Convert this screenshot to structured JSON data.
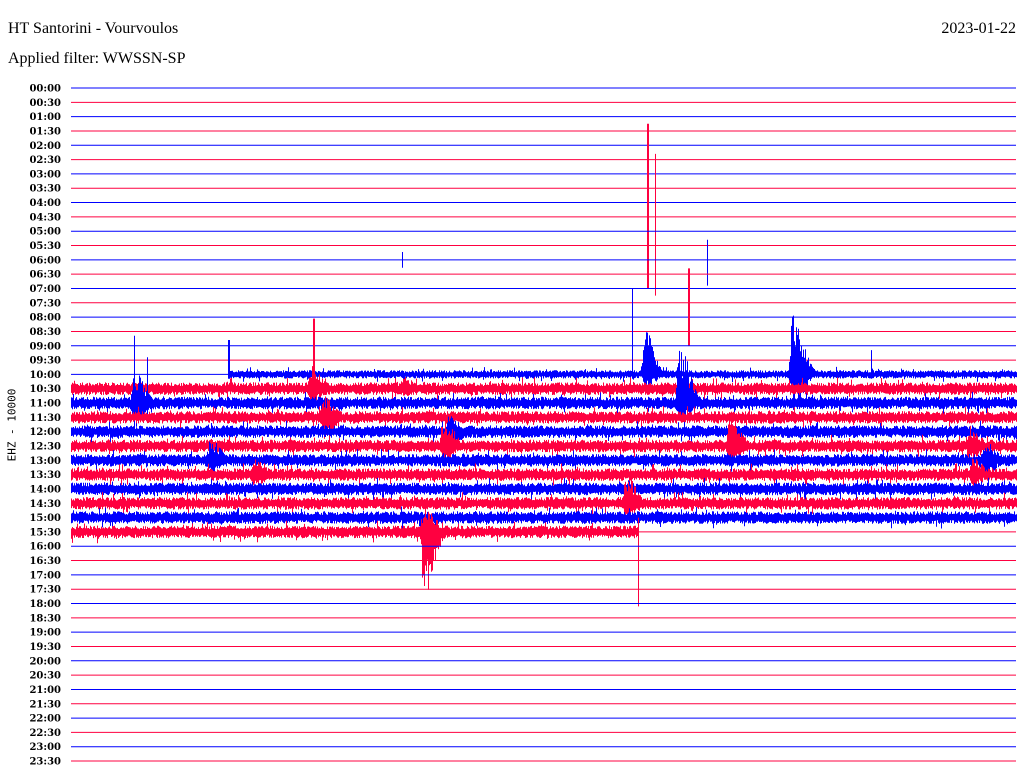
{
  "header": {
    "title": "HT Santorini - Vourvoulos",
    "filter": "Applied filter: WWSSN-SP",
    "date": "2023-01-22"
  },
  "chart_data": {
    "type": "helicorder",
    "ylabel": "EHZ - 10000",
    "minutes_per_row": 30,
    "row_labels": [
      "00:00",
      "00:30",
      "01:00",
      "01:30",
      "02:00",
      "02:30",
      "03:00",
      "03:30",
      "04:00",
      "04:30",
      "05:00",
      "05:30",
      "06:00",
      "06:30",
      "07:00",
      "07:30",
      "08:00",
      "08:30",
      "09:00",
      "09:30",
      "10:00",
      "10:30",
      "11:00",
      "11:30",
      "12:00",
      "12:30",
      "13:00",
      "13:30",
      "14:00",
      "14:30",
      "15:00",
      "15:30",
      "16:00",
      "16:30",
      "17:00",
      "17:30",
      "18:00",
      "18:30",
      "19:00",
      "19:30",
      "20:00",
      "20:30",
      "21:00",
      "21:30",
      "22:00",
      "22:30",
      "23:00",
      "23:30"
    ],
    "colors": [
      "#0000ff",
      "#ff0040"
    ],
    "data_start": {
      "row": 20,
      "minute": 5.0
    },
    "data_end": {
      "row": 31,
      "minute": 18.0
    },
    "noise_level_rows": 0.42,
    "first_row_noise_rows": 0.28,
    "events": [
      {
        "row": 9,
        "minute": 18.3,
        "up": 6.5,
        "down": 5.0,
        "kind": "spike"
      },
      {
        "row": 9,
        "minute": 18.55,
        "up": 4.4,
        "down": 5.5,
        "kind": "spike"
      },
      {
        "row": 12,
        "minute": 10.5,
        "up": 0.55,
        "down": 0.55,
        "kind": "spike"
      },
      {
        "row": 12,
        "minute": 20.2,
        "up": 1.4,
        "down": 1.8,
        "kind": "spike"
      },
      {
        "row": 17,
        "minute": 19.6,
        "up": 4.4,
        "down": 1.0,
        "kind": "spike"
      },
      {
        "row": 20,
        "minute": 5.0,
        "up": 2.4,
        "down": 0.3,
        "kind": "spike"
      },
      {
        "row": 20,
        "minute": 17.8,
        "up": 6.0,
        "down": 0.3,
        "kind": "spike"
      },
      {
        "row": 20,
        "minute": 18.2,
        "up": 3.1,
        "down": 1.0,
        "kind": "burst"
      },
      {
        "row": 20,
        "minute": 22.9,
        "up": 4.2,
        "down": 2.5,
        "kind": "burst"
      },
      {
        "row": 20,
        "minute": 25.4,
        "up": 1.7,
        "down": 0.3,
        "kind": "spike"
      },
      {
        "row": 21,
        "minute": 7.7,
        "up": 4.9,
        "down": 0.8,
        "kind": "spike"
      },
      {
        "row": 21,
        "minute": 7.6,
        "up": 1.6,
        "down": 1.2,
        "kind": "burst"
      },
      {
        "row": 21,
        "minute": 10.5,
        "up": 1.0,
        "down": 0.6,
        "kind": "burst"
      },
      {
        "row": 22,
        "minute": 2.0,
        "up": 4.7,
        "down": 1.5,
        "kind": "spike"
      },
      {
        "row": 22,
        "minute": 2.0,
        "up": 2.2,
        "down": 1.8,
        "kind": "burst"
      },
      {
        "row": 22,
        "minute": 2.4,
        "up": 3.2,
        "down": 1.0,
        "kind": "spike"
      },
      {
        "row": 22,
        "minute": 19.3,
        "up": 4.1,
        "down": 1.5,
        "kind": "burst"
      },
      {
        "row": 23,
        "minute": 8.0,
        "up": 1.5,
        "down": 1.6,
        "kind": "burst"
      },
      {
        "row": 24,
        "minute": 12.0,
        "up": 1.2,
        "down": 1.3,
        "kind": "burst"
      },
      {
        "row": 25,
        "minute": 11.8,
        "up": 2.0,
        "down": 1.3,
        "kind": "burst"
      },
      {
        "row": 25,
        "minute": 20.9,
        "up": 2.3,
        "down": 1.5,
        "kind": "burst"
      },
      {
        "row": 25,
        "minute": 28.5,
        "up": 1.5,
        "down": 1.2,
        "kind": "burst"
      },
      {
        "row": 26,
        "minute": 4.4,
        "up": 1.5,
        "down": 1.0,
        "kind": "burst"
      },
      {
        "row": 26,
        "minute": 29.0,
        "up": 1.4,
        "down": 1.2,
        "kind": "burst"
      },
      {
        "row": 27,
        "minute": 5.8,
        "up": 1.4,
        "down": 1.0,
        "kind": "burst"
      },
      {
        "row": 27,
        "minute": 28.6,
        "up": 1.2,
        "down": 1.0,
        "kind": "burst"
      },
      {
        "row": 29,
        "minute": 17.6,
        "up": 2.0,
        "down": 1.4,
        "kind": "burst"
      },
      {
        "row": 31,
        "minute": 11.2,
        "up": 2.2,
        "down": 4.6,
        "kind": "burst"
      },
      {
        "row": 31,
        "minute": 18.0,
        "up": 1.0,
        "down": 5.2,
        "kind": "spike"
      }
    ]
  }
}
